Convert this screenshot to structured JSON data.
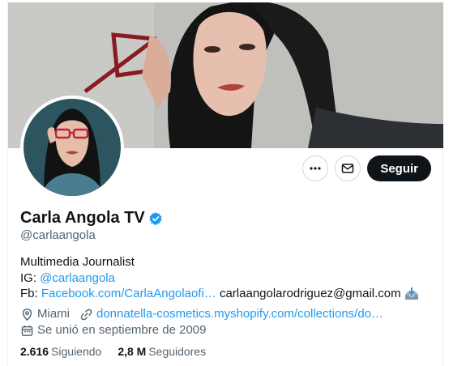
{
  "profile": {
    "name": "Carla Angola TV",
    "handle": "@carlaangola",
    "follow_label": "Seguir",
    "bio": {
      "line1": "Multimedia Journalist",
      "ig_prefix": "IG: ",
      "ig_link": "@carlaangola",
      "fb_prefix": "Fb: ",
      "fb_link": "Facebook.com/CarlaAngolaofi…",
      "email": " carlaangolarodriguez@gmail.com "
    },
    "location": "Miami",
    "website": "donnatella-cosmetics.myshopify.com/collections/do…",
    "joined": "Se unió en septiembre de 2009",
    "following_count": "2.616",
    "following_label": "Siguiendo",
    "followers_count": "2,8 M",
    "followers_label": "Seguidores"
  },
  "colors": {
    "accent": "#1d9bf0",
    "secondary_text": "#536471",
    "follow_bg": "#0f1419"
  }
}
